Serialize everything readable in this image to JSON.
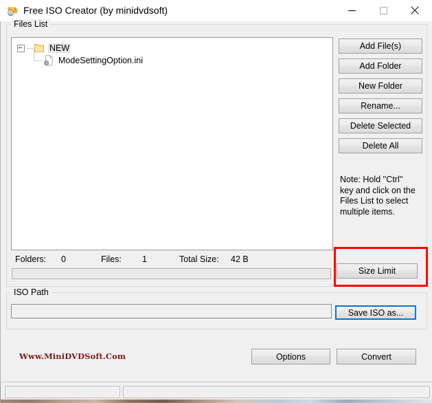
{
  "window": {
    "title": "Free ISO Creator (by minidvdsoft)",
    "icon": "app-disc-icon",
    "controls": {
      "minimize": "minimize-icon",
      "maximize": "maximize-icon",
      "close": "close-icon"
    }
  },
  "files_group": {
    "legend": "Files List",
    "tree": {
      "root": {
        "label": "NEW",
        "icon": "folder-icon",
        "expanded": true,
        "selected": true
      },
      "children": [
        {
          "label": "ModeSettingOption.ini",
          "icon": "ini-file-icon"
        }
      ]
    },
    "buttons": [
      {
        "id": "add-files",
        "label": "Add File(s)"
      },
      {
        "id": "add-folder",
        "label": "Add Folder"
      },
      {
        "id": "new-folder",
        "label": "New Folder"
      },
      {
        "id": "rename",
        "label": "Rename..."
      },
      {
        "id": "delete-selected",
        "label": "Delete Selected"
      },
      {
        "id": "delete-all",
        "label": "Delete All"
      }
    ],
    "note": "Note: Hold ''Ctrl'' key and click on the Files List to select multiple items.",
    "status": {
      "folders_label": "Folders:",
      "folders_value": "0",
      "files_label": "Files:",
      "files_value": "1",
      "total_size_label": "Total Size:",
      "total_size_value": "42 B"
    },
    "progress_percent": "0"
  },
  "size_limit": {
    "label": "Size Limit",
    "highlight_color": "#ff0000",
    "highlighted": true
  },
  "iso_group": {
    "legend": "ISO Path",
    "path_value": "",
    "path_placeholder": "",
    "save_button_label": "Save ISO as...",
    "save_button_focus_color": "#0078d7"
  },
  "footer": {
    "watermark": "Www.MiniDVDSoft.Com",
    "watermark_color": "#7b1a1a",
    "options_label": "Options",
    "convert_label": "Convert"
  },
  "statusbar": {
    "panel_one": "",
    "panel_two": ""
  }
}
